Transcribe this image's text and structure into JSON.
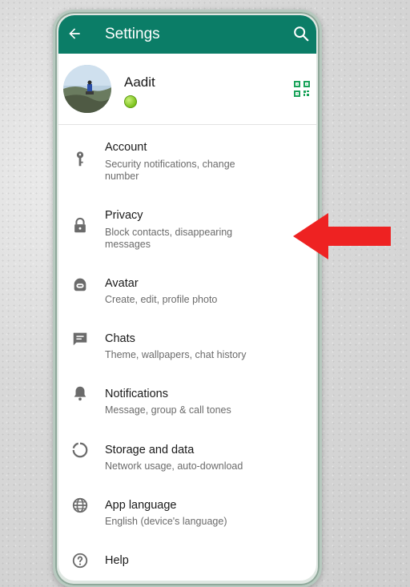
{
  "appbar": {
    "title": "Settings"
  },
  "profile": {
    "name": "Aadit"
  },
  "menu": [
    {
      "label": "Account",
      "sub": "Security notifications, change number",
      "icon": "key-icon"
    },
    {
      "label": "Privacy",
      "sub": "Block contacts, disappearing messages",
      "icon": "lock-icon"
    },
    {
      "label": "Avatar",
      "sub": "Create, edit, profile photo",
      "icon": "avatar-icon"
    },
    {
      "label": "Chats",
      "sub": "Theme, wallpapers, chat history",
      "icon": "chat-icon"
    },
    {
      "label": "Notifications",
      "sub": "Message, group & call tones",
      "icon": "bell-icon"
    },
    {
      "label": "Storage and data",
      "sub": "Network usage, auto-download",
      "icon": "storage-icon"
    },
    {
      "label": "App language",
      "sub": "English (device's language)",
      "icon": "globe-icon"
    },
    {
      "label": "Help",
      "sub": "",
      "icon": "help-icon"
    }
  ],
  "colors": {
    "appbar": "#0b7d67",
    "qr": "#1aa35a",
    "arrow": "#ee2222",
    "status": "#7cc21d"
  }
}
